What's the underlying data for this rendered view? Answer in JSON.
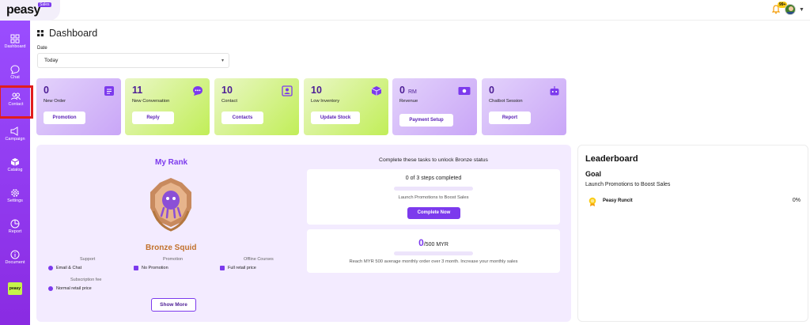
{
  "app": {
    "logo": "peasy",
    "logo_tag": "Sales",
    "notification_badge": "99+"
  },
  "sidebar": {
    "items": [
      {
        "label": "Dashboard",
        "icon": "grid-icon"
      },
      {
        "label": "Chat",
        "icon": "chat-bubble-icon"
      },
      {
        "label": "Contact",
        "icon": "users-icon"
      },
      {
        "label": "Campaign",
        "icon": "megaphone-icon"
      },
      {
        "label": "Catalog",
        "icon": "cube-icon"
      },
      {
        "label": "Settings",
        "icon": "gear-icon"
      },
      {
        "label": "Report",
        "icon": "pie-chart-icon"
      },
      {
        "label": "Document",
        "icon": "info-icon"
      }
    ],
    "mini_logo": "peasy"
  },
  "header": {
    "title": "Dashboard",
    "date_label": "Date",
    "date_value": "Today"
  },
  "cards": [
    {
      "value": "0",
      "unit": "",
      "label": "New Order",
      "button": "Promotion",
      "icon": "receipt-icon"
    },
    {
      "value": "11",
      "unit": "",
      "label": "New Conversation",
      "button": "Reply",
      "icon": "chat-dots-icon"
    },
    {
      "value": "10",
      "unit": "",
      "label": "Contact",
      "button": "Contacts",
      "icon": "contact-card-icon"
    },
    {
      "value": "10",
      "unit": "",
      "label": "Low Inventory",
      "button": "Update Stock",
      "icon": "box-icon"
    },
    {
      "value": "0",
      "unit": "RM",
      "label": "Revenue",
      "button": "Payment Setup",
      "icon": "cash-icon"
    },
    {
      "value": "0",
      "unit": "",
      "label": "Chatbot Session",
      "button": "Report",
      "icon": "robot-icon"
    }
  ],
  "rank": {
    "title": "My Rank",
    "name": "Bronze Squid",
    "benefits": [
      {
        "heading": "Support",
        "value": "Email & Chat"
      },
      {
        "heading": "Promotion",
        "value": "No Promotion"
      },
      {
        "heading": "Offline Courses",
        "value": "Full retail price"
      },
      {
        "heading": "Subscription fee",
        "value": "Normal retail price"
      }
    ],
    "show_more": "Show More"
  },
  "tasks": {
    "heading": "Complete these tasks to unlock Bronze status",
    "task1": {
      "steps": "0 of 3 steps completed",
      "progress": 0,
      "desc": "Launch Promotions to Boost Sales",
      "button": "Complete Now"
    },
    "task2": {
      "current": "0",
      "target": "/500 MYR",
      "progress": 0,
      "desc": "Reach MYR 500 average monthly order over 3 month. Increase your monthly sales"
    }
  },
  "leaderboard": {
    "title": "Leaderboard",
    "goal_title": "Goal",
    "goal_desc": "Launch Promotions to Boost Sales",
    "rows": [
      {
        "name": "Peasy Runcit",
        "pct": "0%"
      }
    ]
  }
}
